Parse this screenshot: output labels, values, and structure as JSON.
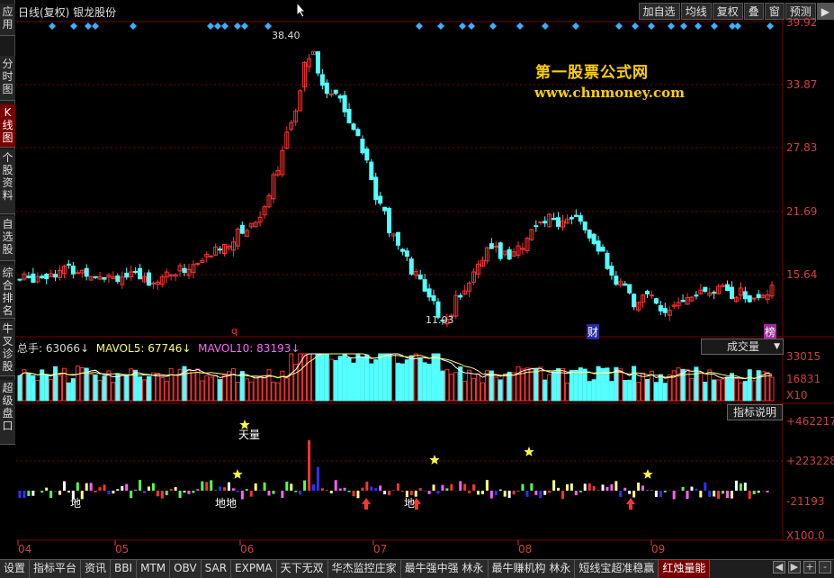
{
  "title": "日线(复权) 银龙股份",
  "toolbar": [
    "加自选",
    "均线",
    "复权",
    "叠",
    "窗",
    "预测",
    "▶"
  ],
  "left_tabs": [
    {
      "label": "应用",
      "lines": [
        "应",
        "用"
      ],
      "active": false
    },
    {
      "label": "分时图",
      "lines": [
        "分",
        "时",
        "图"
      ],
      "active": false
    },
    {
      "label": "K线图",
      "lines": [
        "K",
        "线",
        "图"
      ],
      "active": true
    },
    {
      "label": "个股资料",
      "lines": [
        "个",
        "股",
        "资",
        "料"
      ],
      "active": false
    },
    {
      "label": "自选股",
      "lines": [
        "自",
        "选",
        "股"
      ],
      "active": false
    },
    {
      "label": "综合排名",
      "lines": [
        "综",
        "合",
        "排",
        "名"
      ],
      "active": false
    },
    {
      "label": "牛叉诊股",
      "lines": [
        "牛",
        "叉",
        "诊",
        "股"
      ],
      "active": false
    },
    {
      "label": "超级盘口",
      "lines": [
        "超",
        "级",
        "盘",
        "口"
      ],
      "active": false
    }
  ],
  "watermark": {
    "line1": "第一股票公式网",
    "line2": "www.chnmoney.com"
  },
  "price_axis": [
    "39.92",
    "33.87",
    "27.83",
    "21.69",
    "15.64"
  ],
  "price_marks": {
    "high": "38.40",
    "low": "11.03"
  },
  "event_markers": [
    "q",
    "财",
    "榜"
  ],
  "volume_legend": {
    "total_label": "总手:",
    "total_value": "63066",
    "mavol5_label": "MAVOL5:",
    "mavol5_value": "67746",
    "mavol10_label": "MAVOL10:",
    "mavol10_value": "83193"
  },
  "volume_selector": "成交量",
  "volume_axis": [
    "33015",
    "16831",
    "X10"
  ],
  "indicator_button": "指标说明",
  "indicator_axis": [
    "+462217",
    "+223228",
    "-21193",
    "X100.0"
  ],
  "indicator_labels": {
    "tian": "天量",
    "di": "地",
    "di2": "地地",
    "di3": "地"
  },
  "months": [
    "04",
    "05",
    "06",
    "07",
    "08",
    "09"
  ],
  "bottom_tabs": [
    "设置",
    "指标平台",
    "资讯",
    "BBI",
    "MTM",
    "OBV",
    "SAR",
    "EXPMA",
    "天下无双",
    "华杰监控庄家",
    "最牛强中强 林永",
    "最牛赚机构 林永",
    "短线宝超准稳赢",
    "红烛量能"
  ],
  "active_bottom_tab": "红烛量能",
  "page_nav": [
    "◀",
    "▶",
    "+",
    "-"
  ],
  "colors": {
    "up": "#ff3232",
    "down": "#54ffff",
    "grid": "#7a0000",
    "axis": "#d04040",
    "star": "#ffff40"
  }
}
